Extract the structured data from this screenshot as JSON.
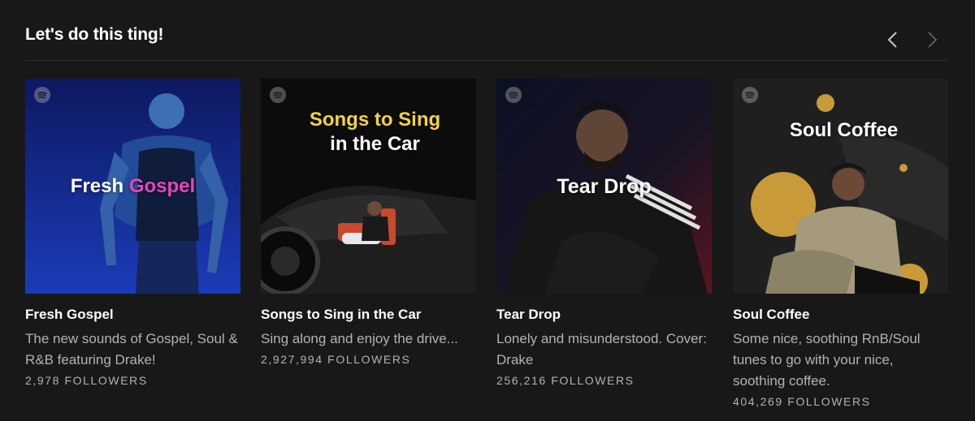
{
  "shelf": {
    "title": "Let's do this ting!",
    "prev_icon": "chevron-left-icon",
    "next_icon": "chevron-right-icon"
  },
  "cards": [
    {
      "name": "Fresh Gospel",
      "cover_text_1": "Fresh",
      "cover_text_2": "Gospel",
      "accent": "#e845b9",
      "description": "The new sounds of Gospel, Soul & R&B featuring Drake!",
      "followers": "2,978 FOLLOWERS"
    },
    {
      "name": "Songs to Sing in the Car",
      "cover_text_1": "Songs to Sing",
      "cover_text_2": "in the Car",
      "accent": "#f3d43c",
      "description": "Sing along and enjoy the drive...",
      "followers": "2,927,994 FOLLOWERS"
    },
    {
      "name": "Tear Drop",
      "cover_text_1": "Tear Drop",
      "description": "Lonely and misunderstood. Cover: Drake",
      "followers": "256,216 FOLLOWERS"
    },
    {
      "name": "Soul Coffee",
      "cover_text_1": "Soul Coffee",
      "accent": "#d9a93a",
      "description": "Some nice, soothing RnB/Soul tunes to go with your nice, soothing coffee.",
      "followers": "404,269 FOLLOWERS"
    }
  ]
}
